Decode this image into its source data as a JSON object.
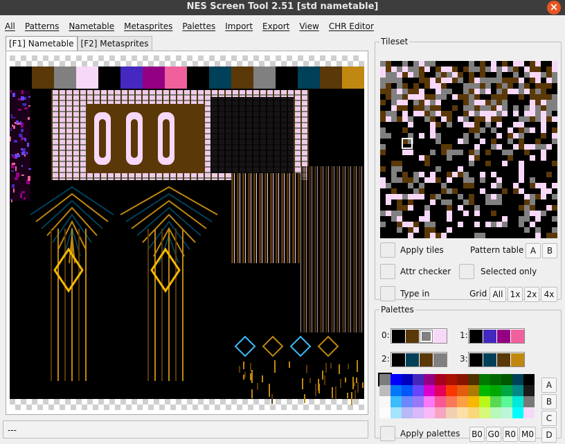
{
  "window": {
    "title": "NES Screen Tool 2.51  [std nametable]",
    "close": "×"
  },
  "menu": [
    "All",
    "Patterns",
    "Nametable",
    "Metasprites",
    "Palettes",
    "Import",
    "Export",
    "View",
    "CHR Editor"
  ],
  "tabs": [
    "[F1] Nametable",
    "[F2] Metasprites"
  ],
  "status": "---",
  "tileset": {
    "legend": "Tileset",
    "apply_tiles": "Apply tiles",
    "pattern_table_label": "Pattern table",
    "pattern_table_buttons": [
      "A",
      "B"
    ],
    "attr_checker": "Attr checker",
    "selected_only": "Selected only",
    "type_in": "Type in",
    "grid_label": "Grid",
    "grid_buttons": [
      "All",
      "1x",
      "2x",
      "4x"
    ]
  },
  "palettes": {
    "legend": "Palettes",
    "labels": [
      "0:",
      "1:",
      "2:",
      "3:"
    ],
    "sets": [
      [
        "#000000",
        "#5a3808",
        "#808080",
        "#f8d8f8"
      ],
      [
        "#000000",
        "#4428c0",
        "#940084",
        "#f0609c"
      ],
      [
        "#000000",
        "#004058",
        "#5a3808",
        "#808080"
      ],
      [
        "#000000",
        "#004058",
        "#5a3808",
        "#c08810"
      ]
    ],
    "side_buttons": [
      "A",
      "B",
      "C",
      "D"
    ],
    "apply_palettes": "Apply palettes",
    "reset_buttons": [
      "B0",
      "G0",
      "R0",
      "M0"
    ],
    "master_rows": [
      [
        "#7c7c7c",
        "#0000fc",
        "#0000bc",
        "#4428bc",
        "#940084",
        "#a80020",
        "#a81000",
        "#881400",
        "#503000",
        "#007800",
        "#006800",
        "#005800",
        "#004058",
        "#000000"
      ],
      [
        "#bcbcbc",
        "#0078f8",
        "#0058f8",
        "#6844fc",
        "#d800cc",
        "#e40058",
        "#f83800",
        "#e45c10",
        "#ac7c00",
        "#00b800",
        "#00a800",
        "#00a844",
        "#008888",
        "#1a1a1a"
      ],
      [
        "#f8f8f8",
        "#3cbcfc",
        "#6888fc",
        "#9878f8",
        "#f878f8",
        "#f85898",
        "#f87858",
        "#fca044",
        "#f8b800",
        "#b8f818",
        "#58d854",
        "#58f898",
        "#00e8d8",
        "#787878"
      ],
      [
        "#fcfcfc",
        "#a4e4fc",
        "#b8b8f8",
        "#d8b8f8",
        "#f8b8f8",
        "#f8a4c0",
        "#f0d0b0",
        "#fce0a8",
        "#f8d878",
        "#d8f878",
        "#b8f8b8",
        "#b8f8d8",
        "#00fcfc",
        "#f8d8f8"
      ]
    ]
  },
  "nametable_palette_strip": [
    "#000000",
    "#5a3808",
    "#808080",
    "#f8d8f8",
    "#000000",
    "#4428c0",
    "#940084",
    "#f0609c",
    "#000000",
    "#004058",
    "#5a3808",
    "#808080",
    "#000000",
    "#004058",
    "#5a3808",
    "#c08810"
  ]
}
